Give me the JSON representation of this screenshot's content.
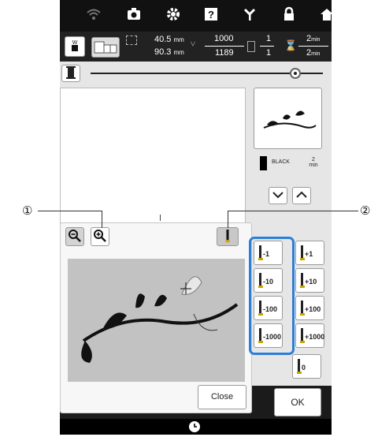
{
  "callouts": {
    "one": "①",
    "two": "②"
  },
  "top_icons": [
    "wifi-icon",
    "camera-icon",
    "settings-gear-icon",
    "help-icon",
    "needle-icon",
    "lock-icon",
    "home-icon"
  ],
  "info": {
    "width": "40.5",
    "height": "90.3",
    "unit_mm": "mm",
    "stitch_current": "1000",
    "stitch_total": "1189",
    "color_current": "1",
    "color_total": "1",
    "time_current": "2",
    "time_total": "2",
    "unit_min": "min"
  },
  "slider": {
    "position": 0.88
  },
  "thread": {
    "color_name": "BLACK",
    "color_hex": "#000000",
    "time_value": "2",
    "time_unit": "min"
  },
  "popup": {
    "close_label": "Close"
  },
  "ok_label": "OK",
  "minus_buttons": [
    "-1",
    "-10",
    "-100",
    "-1000"
  ],
  "plus_buttons": [
    "+1",
    "+10",
    "+100",
    "+1000"
  ],
  "zero_label": "0",
  "colors": {
    "highlight": "#2b7fd6",
    "needle_gold": "#c9a300"
  }
}
